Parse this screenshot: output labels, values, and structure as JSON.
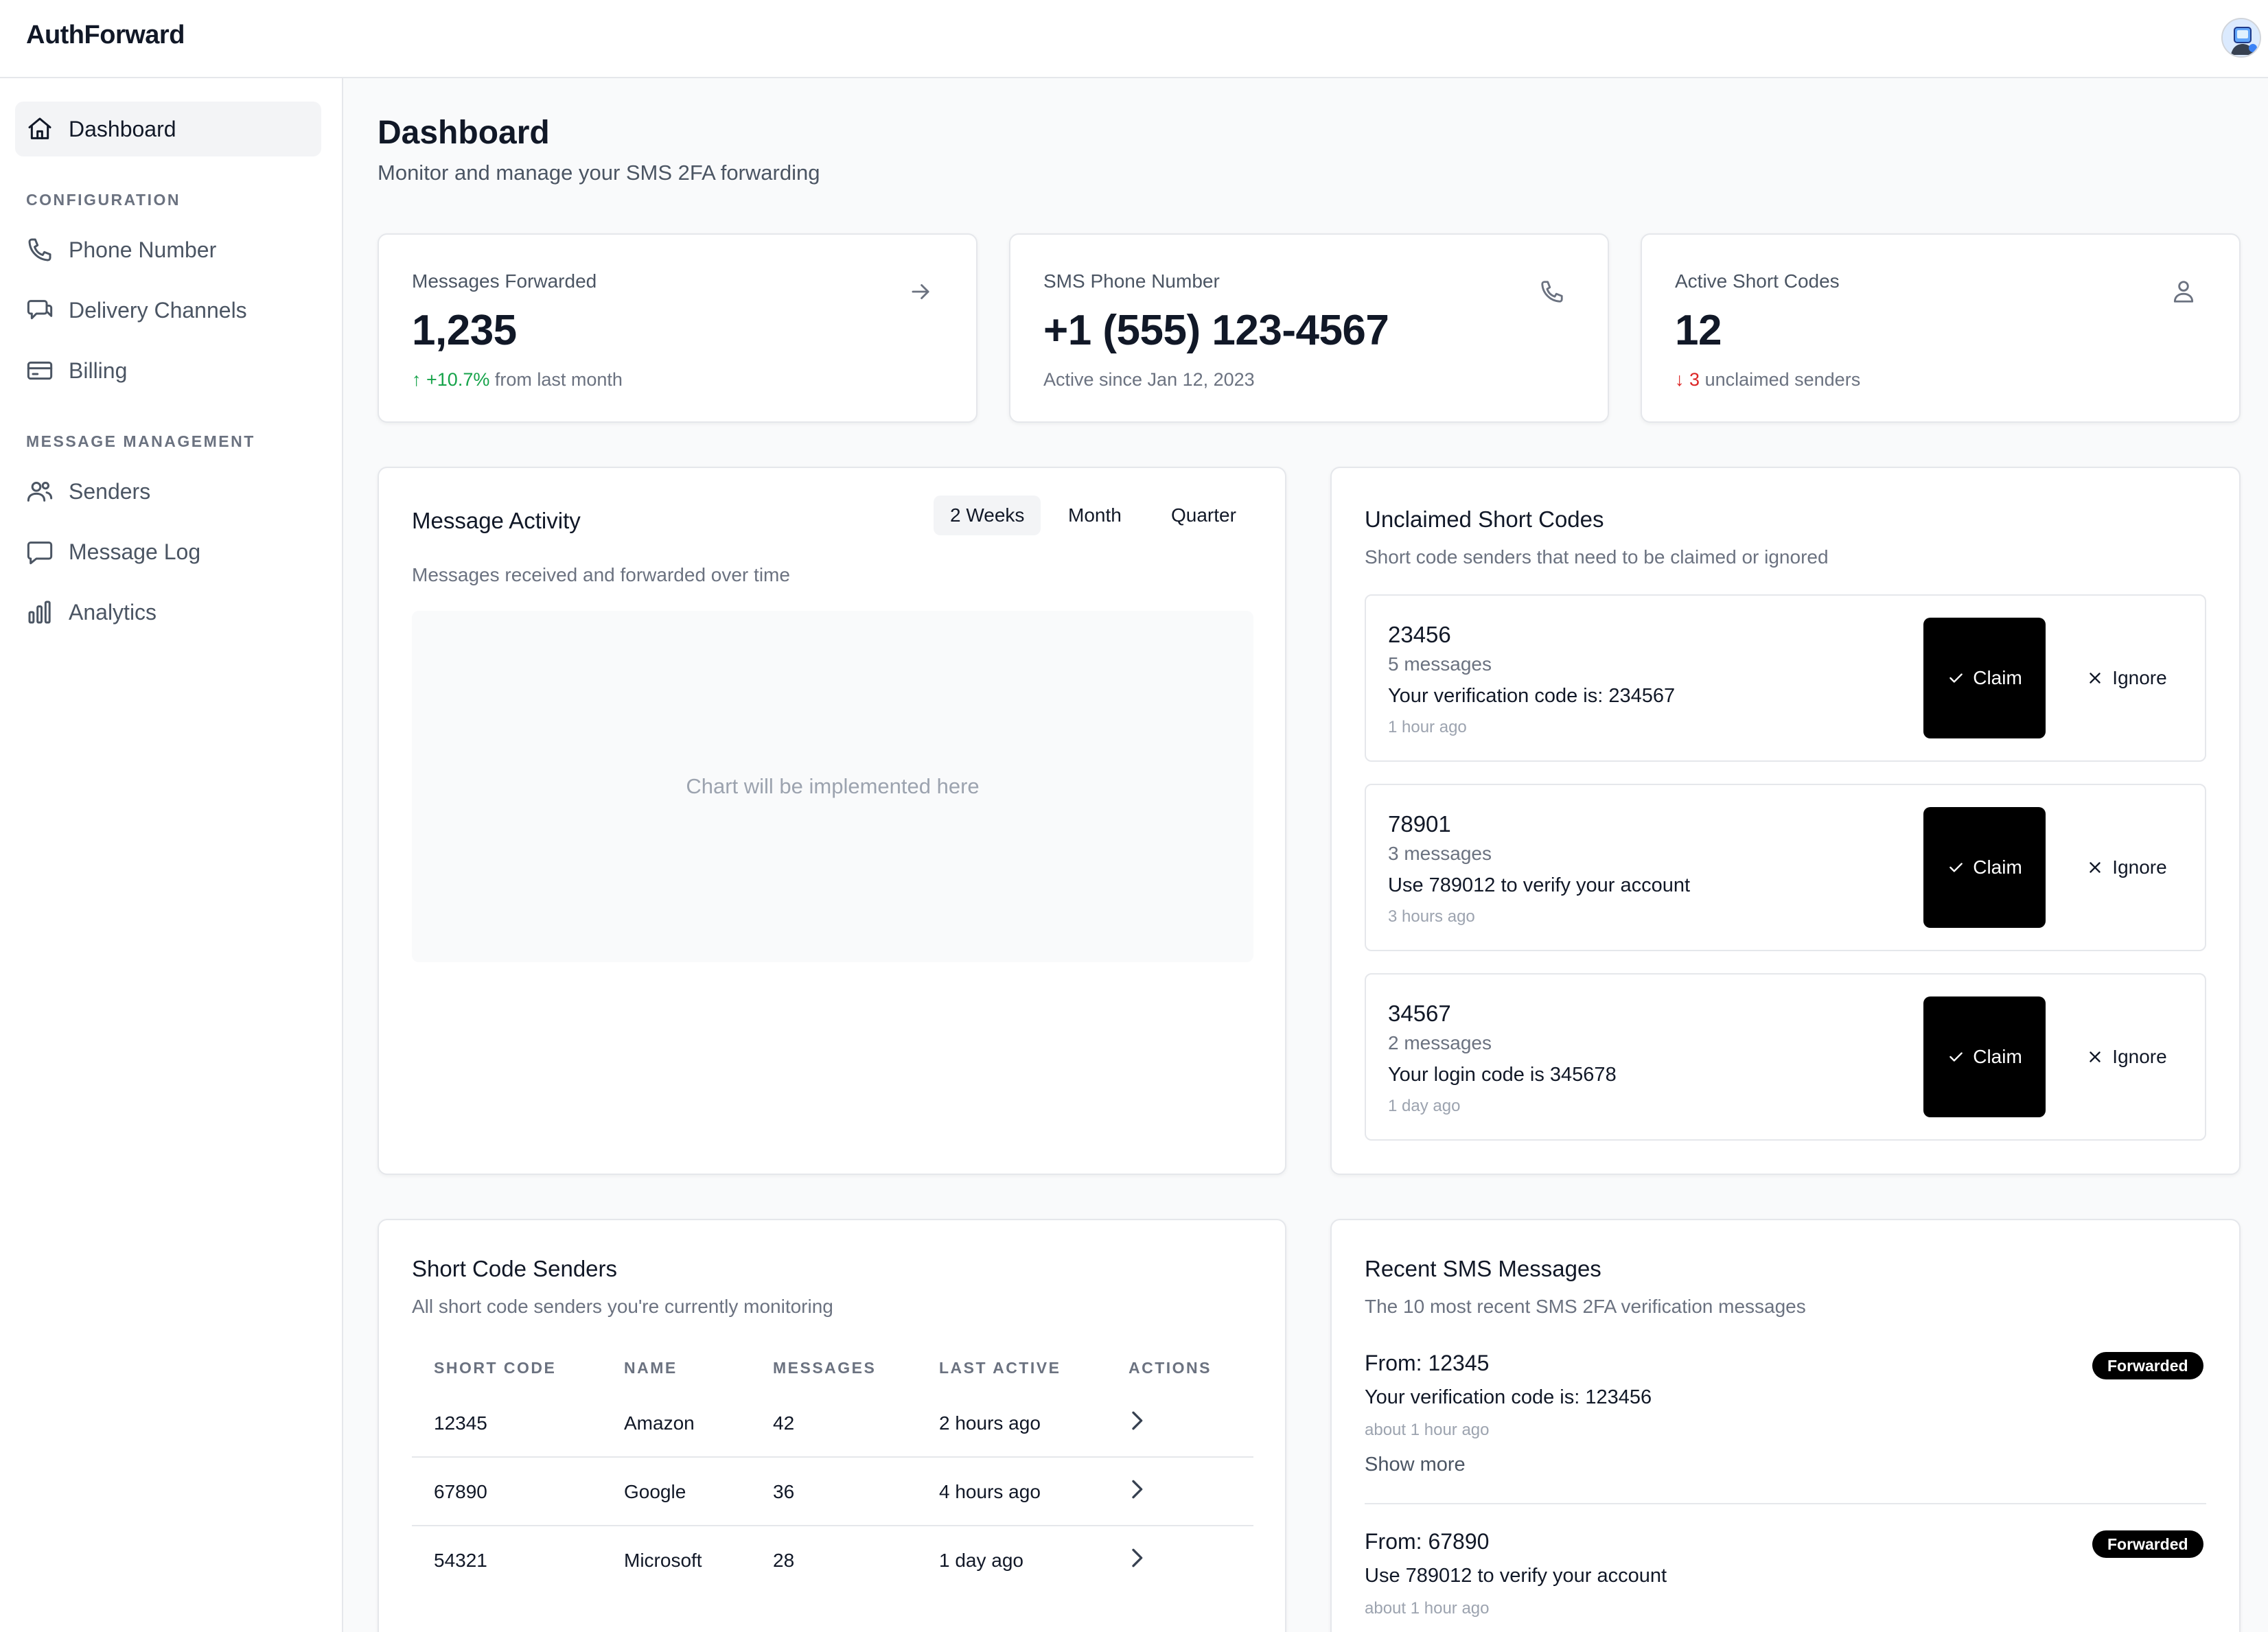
{
  "app": {
    "brand": "AuthForward"
  },
  "sidebar": {
    "dashboard": "Dashboard",
    "section_config": "CONFIGURATION",
    "config_items": [
      "Phone Number",
      "Delivery Channels",
      "Billing"
    ],
    "section_msg": "MESSAGE MANAGEMENT",
    "msg_items": [
      "Senders",
      "Message Log",
      "Analytics"
    ]
  },
  "page": {
    "title": "Dashboard",
    "subtitle": "Monitor and manage your SMS 2FA forwarding"
  },
  "stats": [
    {
      "label": "Messages Forwarded",
      "value": "1,235",
      "change": "+10.7%",
      "note": "from last month",
      "icon": "arrow-right-icon"
    },
    {
      "label": "SMS Phone Number",
      "value": "+1 (555) 123-4567",
      "note": "Active since Jan 12, 2023",
      "icon": "phone-icon"
    },
    {
      "label": "Active Short Codes",
      "value": "12",
      "change": "3",
      "note": "unclaimed senders",
      "icon": "users-icon"
    }
  ],
  "activity": {
    "title": "Message Activity",
    "subtitle": "Messages received and forwarded over time",
    "tabs": [
      "2 Weeks",
      "Month",
      "Quarter"
    ],
    "active_tab": "2 Weeks",
    "placeholder": "Chart will be implemented here"
  },
  "unclaimed": {
    "title": "Unclaimed Short Codes",
    "subtitle": "Short code senders that need to be claimed or ignored",
    "claim_label": "Claim",
    "ignore_label": "Ignore",
    "items": [
      {
        "code": "23456",
        "count": "5 messages",
        "message": "Your verification code is: 234567",
        "time": "1 hour ago"
      },
      {
        "code": "78901",
        "count": "3 messages",
        "message": "Use 789012 to verify your account",
        "time": "3 hours ago"
      },
      {
        "code": "34567",
        "count": "2 messages",
        "message": "Your login code is 345678",
        "time": "1 day ago"
      }
    ]
  },
  "senders": {
    "title": "Short Code Senders",
    "subtitle": "All short code senders you're currently monitoring",
    "columns": [
      "SHORT CODE",
      "NAME",
      "MESSAGES",
      "LAST ACTIVE",
      "ACTIONS"
    ],
    "rows": [
      [
        "12345",
        "Amazon",
        "42",
        "2 hours ago"
      ],
      [
        "67890",
        "Google",
        "36",
        "4 hours ago"
      ],
      [
        "54321",
        "Microsoft",
        "28",
        "1 day ago"
      ]
    ]
  },
  "recent": {
    "title": "Recent SMS Messages",
    "subtitle": "The 10 most recent SMS 2FA verification messages",
    "show_more": "Show more",
    "messages": [
      {
        "from": "From: 12345",
        "body": "Your verification code is: 123456",
        "time": "about 1 hour ago",
        "status": "Forwarded"
      },
      {
        "from": "From: 67890",
        "body": "Use 789012 to verify your account",
        "time": "about 1 hour ago",
        "status": "Forwarded"
      }
    ]
  },
  "colors": {
    "accent": "#000000",
    "up": "#16a34a",
    "down": "#dc2626",
    "border": "#e5e7eb"
  }
}
